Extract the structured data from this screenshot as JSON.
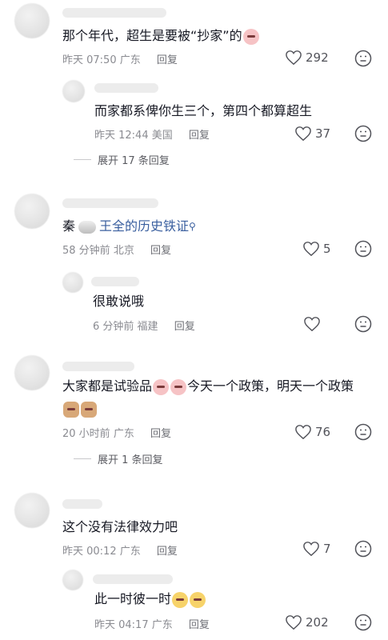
{
  "comments": [
    {
      "text": "那个年代，超生是要被“抄家”的",
      "time": "昨天 07:50",
      "location": "广东",
      "reply": "回复",
      "likes": "292",
      "replies": [
        {
          "text": "而家都系俾你生三个，第四个都算超生",
          "time": "昨天 12:44",
          "location": "美国",
          "reply": "回复",
          "likes": "37"
        }
      ],
      "expand": "展开 17 条回复"
    },
    {
      "text_prefix": "秦",
      "link_text": "王全的历史铁证",
      "time": "58 分钟前",
      "location": "北京",
      "reply": "回复",
      "likes": "5",
      "replies": [
        {
          "text": "很敢说哦",
          "time": "6 分钟前",
          "location": "福建",
          "reply": "回复",
          "likes": ""
        }
      ]
    },
    {
      "text_prefix": "大家都是试验品",
      "text_suffix": "今天一个政策，明天一个政策",
      "time": "20 小时前",
      "location": "广东",
      "reply": "回复",
      "likes": "76",
      "expand": "展开 1 条回复"
    },
    {
      "text": "这个没有法律效力吧",
      "time": "昨天 00:12",
      "location": "广东",
      "reply": "回复",
      "likes": "7",
      "replies": [
        {
          "text": "此一时彼一时",
          "time": "昨天 04:17",
          "location": "广东",
          "reply": "回复",
          "likes": "202"
        }
      ]
    }
  ]
}
